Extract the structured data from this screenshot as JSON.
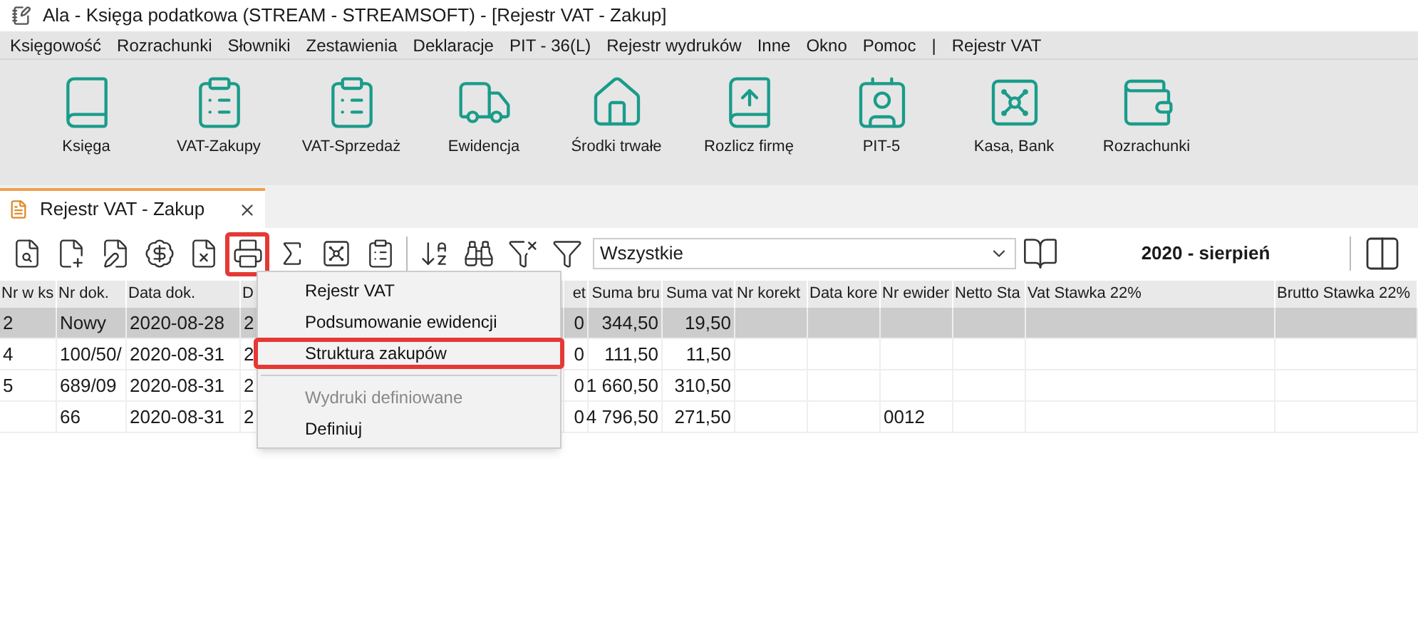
{
  "window": {
    "title": "Ala - Księga podatkowa (STREAM - STREAMSOFT) - [Rejestr VAT - Zakup]"
  },
  "menu_bar": [
    "Księgowość",
    "Rozrachunki",
    "Słowniki",
    "Zestawienia",
    "Deklaracje",
    "PIT - 36(L)",
    "Rejestr wydruków",
    "Inne",
    "Okno",
    "Pomoc",
    "|",
    "Rejestr VAT"
  ],
  "ribbon": [
    {
      "label": "Księga",
      "kind": "book"
    },
    {
      "label": "VAT-Zakupy",
      "kind": "clipboard-in"
    },
    {
      "label": "VAT-Sprzedaż",
      "kind": "clipboard-out"
    },
    {
      "label": "Ewidencja",
      "kind": "truck"
    },
    {
      "label": "Środki trwałe",
      "kind": "house"
    },
    {
      "label": "Rozlicz firmę",
      "kind": "book-up"
    },
    {
      "label": "PIT-5",
      "kind": "person-doc"
    },
    {
      "label": "Kasa, Bank",
      "kind": "safe"
    },
    {
      "label": "Rozrachunki",
      "kind": "wallet"
    }
  ],
  "tab": {
    "label": "Rejestr VAT - Zakup",
    "selected": true
  },
  "toolbar": [
    {
      "kind": "preview",
      "highlighted": false
    },
    {
      "kind": "add",
      "highlighted": false
    },
    {
      "kind": "edit",
      "highlighted": false
    },
    {
      "kind": "money",
      "highlighted": false
    },
    {
      "kind": "delete",
      "highlighted": false
    },
    {
      "kind": "print",
      "highlighted": true
    },
    {
      "kind": "sum",
      "highlighted": false
    },
    {
      "kind": "safe",
      "highlighted": false
    },
    {
      "kind": "check",
      "highlighted": false
    },
    {
      "kind": "sort",
      "highlighted": false
    },
    {
      "kind": "find",
      "highlighted": false
    },
    {
      "kind": "filter-edit",
      "highlighted": false
    },
    {
      "kind": "filter",
      "highlighted": false
    }
  ],
  "filter_dropdown": {
    "value": "Wszystkie"
  },
  "period": "2020 - sierpień",
  "table": {
    "columns": [
      "Nr w ks",
      "Nr dok.",
      "Data dok.",
      "D",
      "et",
      "Suma bru",
      "Suma vat",
      "Nr korekt",
      "Data kore",
      "Nr ewider",
      "Netto Sta",
      "Vat Stawka 22%",
      "Brutto Stawka 22%"
    ],
    "rows": [
      {
        "selected": true,
        "cells": [
          "2",
          "Nowy",
          "2020-08-28",
          "2",
          "0",
          "344,50",
          "19,50",
          null,
          null,
          null,
          null,
          null,
          null
        ]
      },
      {
        "selected": false,
        "cells": [
          "4",
          "100/50/",
          "2020-08-31",
          "2",
          "0",
          "111,50",
          "11,50",
          null,
          null,
          null,
          null,
          null,
          null
        ]
      },
      {
        "selected": false,
        "cells": [
          "5",
          "689/09",
          "2020-08-31",
          "2",
          "0",
          "1 660,50",
          "310,50",
          null,
          null,
          null,
          null,
          null,
          null
        ]
      },
      {
        "selected": false,
        "cells": [
          null,
          "66",
          "2020-08-31",
          "2",
          "0",
          "4 796,50",
          "271,50",
          null,
          null,
          "0012",
          null,
          null,
          null
        ]
      }
    ]
  },
  "print_menu": {
    "items": [
      {
        "label": "Rejestr VAT",
        "disabled": false,
        "highlighted": false
      },
      {
        "label": "Podsumowanie ewidencji",
        "disabled": false,
        "highlighted": false
      },
      {
        "label": "Struktura zakupów",
        "disabled": false,
        "highlighted": true
      },
      {
        "label": "Wydruki definiowane",
        "disabled": true,
        "highlighted": false
      },
      {
        "label": "Definiuj",
        "disabled": false,
        "highlighted": false
      }
    ]
  }
}
